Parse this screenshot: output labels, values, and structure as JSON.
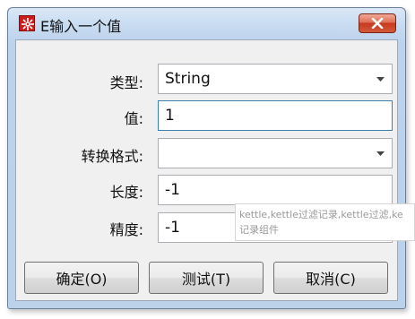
{
  "window": {
    "title": "E输入一个值",
    "close_icon": "close-icon",
    "app_icon": "kettle-app-icon",
    "close_button_color": "#c9391d"
  },
  "form": {
    "type_label": "类型:",
    "type_value": "String",
    "value_label": "值:",
    "value_value": "1",
    "format_label": "转换格式:",
    "format_value": "",
    "length_label": "长度:",
    "length_value": "-1",
    "precision_label": "精度:",
    "precision_value": "-1"
  },
  "buttons": {
    "ok_label": "确定(O)",
    "test_label": "测试(T)",
    "cancel_label": "取消(C)"
  },
  "tooltip": {
    "line1": "kettle,kettle过滤记录,kettle过滤,ke",
    "line2": "记录组件"
  }
}
